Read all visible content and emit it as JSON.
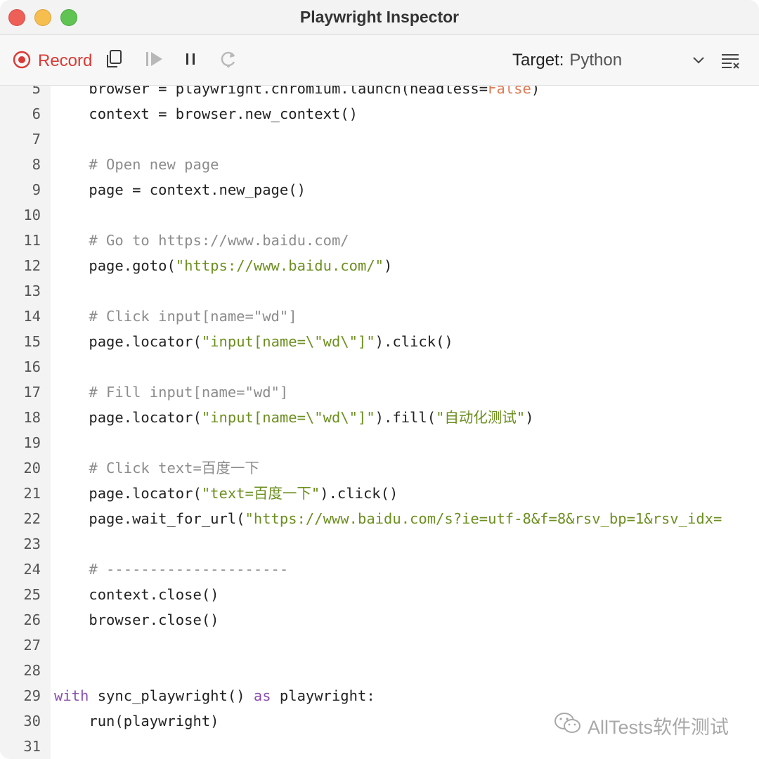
{
  "window": {
    "title": "Playwright Inspector"
  },
  "toolbar": {
    "record_label": "Record",
    "target_label": "Target:",
    "target_value": "Python"
  },
  "colors": {
    "record_red": "#d93a35",
    "comment": "#8c8c8c",
    "string": "#6c8f1f",
    "keyword": "#8a4fb0",
    "boolean": "#e07a54"
  },
  "icons": [
    "record-icon",
    "copy-icon",
    "step-icon",
    "pause-icon",
    "resume-icon",
    "chevron-down-icon",
    "clear-icon",
    "wechat-icon"
  ],
  "code_lines": [
    {
      "n": "5",
      "segs": [
        {
          "t": "    browser = playwright.chromium.launch(headless="
        },
        {
          "t": "False",
          "c": "b"
        },
        {
          "t": ")"
        }
      ]
    },
    {
      "n": "6",
      "segs": [
        {
          "t": "    context = browser.new_context()"
        }
      ]
    },
    {
      "n": "7",
      "segs": []
    },
    {
      "n": "8",
      "segs": [
        {
          "t": "    # Open new page",
          "c": "c"
        }
      ]
    },
    {
      "n": "9",
      "segs": [
        {
          "t": "    page = context.new_page()"
        }
      ]
    },
    {
      "n": "10",
      "segs": []
    },
    {
      "n": "11",
      "segs": [
        {
          "t": "    # Go to https://www.baidu.com/",
          "c": "c"
        }
      ]
    },
    {
      "n": "12",
      "segs": [
        {
          "t": "    page.goto("
        },
        {
          "t": "\"https://www.baidu.com/\"",
          "c": "s"
        },
        {
          "t": ")"
        }
      ]
    },
    {
      "n": "13",
      "segs": []
    },
    {
      "n": "14",
      "segs": [
        {
          "t": "    # Click input[name=\"wd\"]",
          "c": "c"
        }
      ]
    },
    {
      "n": "15",
      "segs": [
        {
          "t": "    page.locator("
        },
        {
          "t": "\"input[name=\\\"wd\\\"]\"",
          "c": "s"
        },
        {
          "t": ").click()"
        }
      ]
    },
    {
      "n": "16",
      "segs": []
    },
    {
      "n": "17",
      "segs": [
        {
          "t": "    # Fill input[name=\"wd\"]",
          "c": "c"
        }
      ]
    },
    {
      "n": "18",
      "segs": [
        {
          "t": "    page.locator("
        },
        {
          "t": "\"input[name=\\\"wd\\\"]\"",
          "c": "s"
        },
        {
          "t": ").fill("
        },
        {
          "t": "\"自动化测试\"",
          "c": "s"
        },
        {
          "t": ")"
        }
      ]
    },
    {
      "n": "19",
      "segs": []
    },
    {
      "n": "20",
      "segs": [
        {
          "t": "    # Click text=百度一下",
          "c": "c"
        }
      ]
    },
    {
      "n": "21",
      "segs": [
        {
          "t": "    page.locator("
        },
        {
          "t": "\"text=百度一下\"",
          "c": "s"
        },
        {
          "t": ").click()"
        }
      ]
    },
    {
      "n": "22",
      "segs": [
        {
          "t": "    page.wait_for_url("
        },
        {
          "t": "\"https://www.baidu.com/s?ie=utf-8&f=8&rsv_bp=1&rsv_idx=",
          "c": "s"
        }
      ]
    },
    {
      "n": "23",
      "segs": []
    },
    {
      "n": "24",
      "segs": [
        {
          "t": "    # ---------------------",
          "c": "c"
        }
      ]
    },
    {
      "n": "25",
      "segs": [
        {
          "t": "    context.close()"
        }
      ]
    },
    {
      "n": "26",
      "segs": [
        {
          "t": "    browser.close()"
        }
      ]
    },
    {
      "n": "27",
      "segs": []
    },
    {
      "n": "28",
      "segs": []
    },
    {
      "n": "29",
      "segs": [
        {
          "t": "with",
          "c": "k"
        },
        {
          "t": " sync_playwright() "
        },
        {
          "t": "as",
          "c": "k"
        },
        {
          "t": " playwright:"
        }
      ]
    },
    {
      "n": "30",
      "segs": [
        {
          "t": "    run(playwright)"
        }
      ]
    },
    {
      "n": "31",
      "segs": []
    }
  ],
  "watermark": {
    "text": "AllTests软件测试"
  }
}
